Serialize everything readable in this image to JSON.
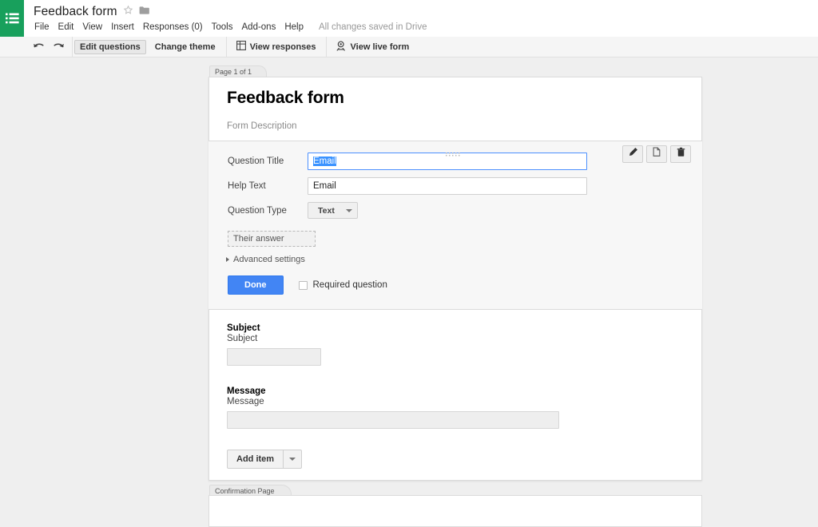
{
  "app": {
    "badge_icon": "forms-list-icon",
    "brand_green": "#18a05c"
  },
  "header": {
    "doc_title": "Feedback form",
    "star_icon": "star-icon",
    "folder_icon": "folder-icon",
    "menu_items": [
      {
        "label": "File"
      },
      {
        "label": "Edit"
      },
      {
        "label": "View"
      },
      {
        "label": "Insert"
      },
      {
        "label": "Responses (0)"
      },
      {
        "label": "Tools"
      },
      {
        "label": "Add-ons"
      },
      {
        "label": "Help"
      }
    ],
    "save_status": "All changes saved in Drive"
  },
  "toolbar": {
    "undo_icon": "undo-icon",
    "redo_icon": "redo-icon",
    "edit_questions": "Edit questions",
    "change_theme": "Change theme",
    "view_responses": "View responses",
    "view_responses_icon": "spreadsheet-icon",
    "view_live_form": "View live form",
    "view_live_form_icon": "live-form-icon"
  },
  "page": {
    "page_tab_label": "Page 1 of 1",
    "form_title": "Feedback form",
    "form_description": "Form Description",
    "confirmation_tab_label": "Confirmation Page"
  },
  "question_editor": {
    "drag_handle_icon": "drag-handle-icon",
    "actions": [
      {
        "icon": "pencil-icon",
        "name": "edit"
      },
      {
        "icon": "duplicate-icon",
        "name": "duplicate"
      },
      {
        "icon": "trash-icon",
        "name": "delete"
      }
    ],
    "question_title_label": "Question Title",
    "question_title_value": "Email",
    "question_title_selected": true,
    "help_text_label": "Help Text",
    "help_text_value": "Email",
    "question_type_label": "Question Type",
    "question_type_value": "Text",
    "question_type_caret_icon": "chevron-down-icon",
    "their_answer_placeholder": "Their answer",
    "advanced_settings": "Advanced settings",
    "advanced_settings_caret_icon": "caret-right-icon",
    "done_label": "Done",
    "required_label": "Required question",
    "required_checked": false
  },
  "preview_questions": [
    {
      "title": "Subject",
      "help": "Subject",
      "field_size": "short"
    },
    {
      "title": "Message",
      "help": "Message",
      "field_size": "long"
    }
  ],
  "add_item": {
    "label": "Add item",
    "caret_icon": "chevron-down-icon"
  },
  "colors": {
    "accent_blue": "#4285f4",
    "selection_blue": "#3b93ff",
    "focus_border": "#4d90fe",
    "brand_green": "#18a05c",
    "page_bg": "#efefef",
    "panel_bg": "#f7f7f7"
  }
}
